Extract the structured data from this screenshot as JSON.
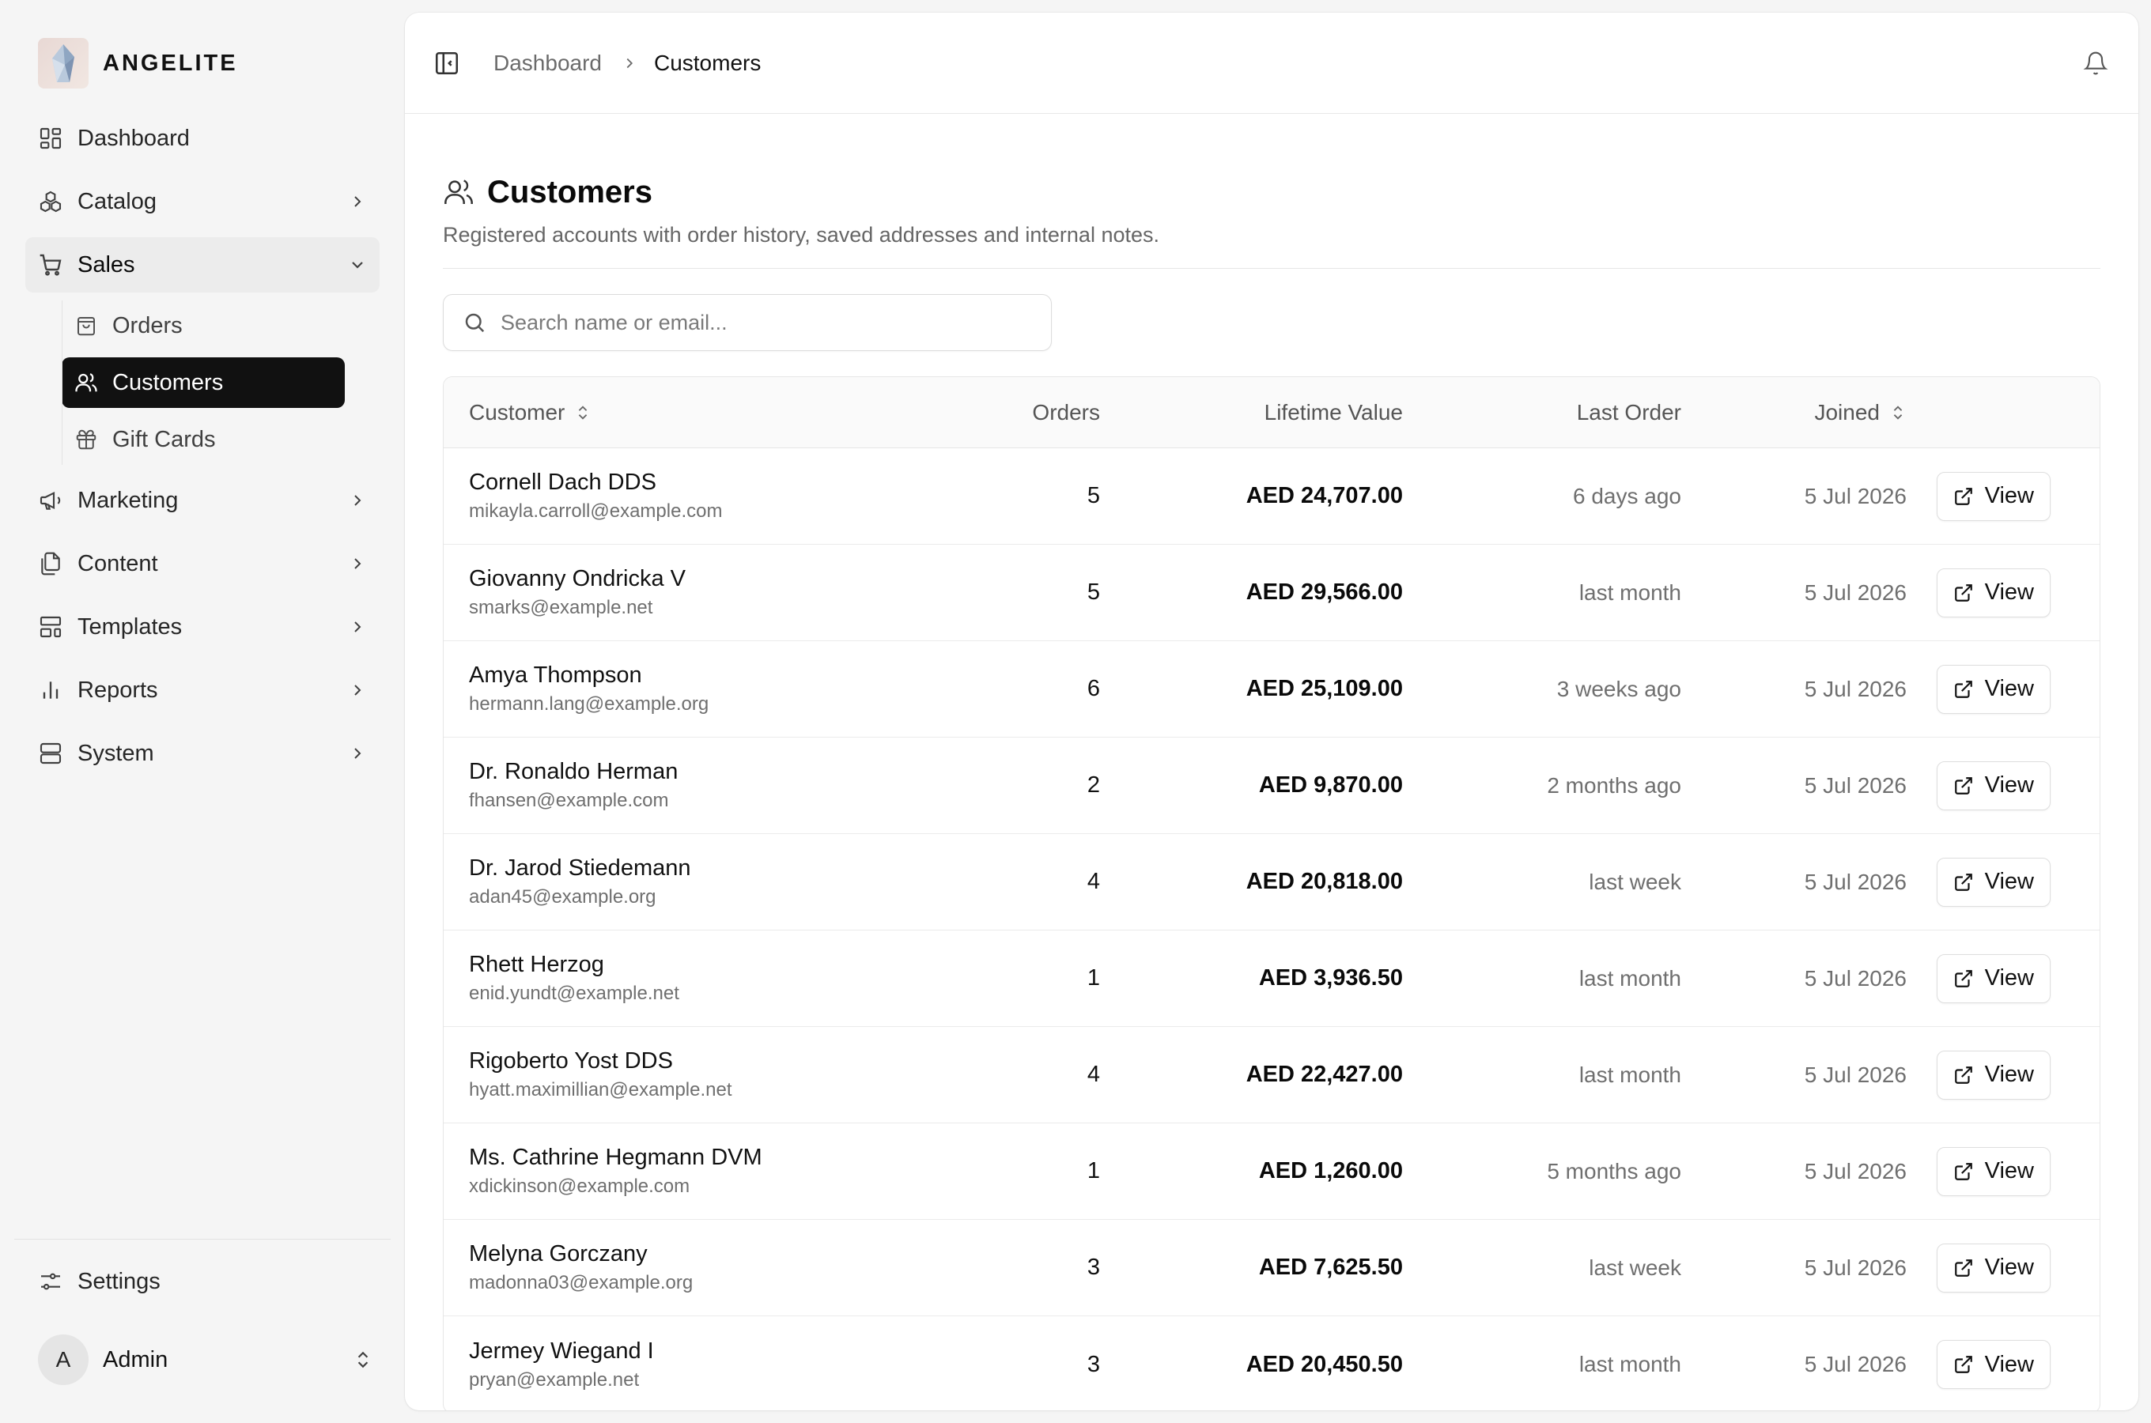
{
  "brand": {
    "name": "ANGELITE"
  },
  "sidebar": {
    "items": [
      {
        "label": "Dashboard",
        "icon": "layout-dashboard-icon"
      },
      {
        "label": "Catalog",
        "icon": "boxes-icon"
      },
      {
        "label": "Sales",
        "icon": "shopping-cart-icon",
        "expanded": true,
        "children": [
          {
            "label": "Orders",
            "icon": "shopping-bag-icon"
          },
          {
            "label": "Customers",
            "icon": "users-icon",
            "active": true
          },
          {
            "label": "Gift Cards",
            "icon": "gift-icon"
          }
        ]
      },
      {
        "label": "Marketing",
        "icon": "megaphone-icon"
      },
      {
        "label": "Content",
        "icon": "files-icon"
      },
      {
        "label": "Templates",
        "icon": "layout-template-icon"
      },
      {
        "label": "Reports",
        "icon": "bar-chart-icon"
      },
      {
        "label": "System",
        "icon": "server-icon"
      }
    ],
    "settings": {
      "label": "Settings",
      "icon": "sliders-icon"
    },
    "user": {
      "initial": "A",
      "name": "Admin"
    }
  },
  "topbar": {
    "breadcrumb": {
      "parent": "Dashboard",
      "current": "Customers"
    }
  },
  "page": {
    "title": "Customers",
    "subtitle": "Registered accounts with order history, saved addresses and internal notes."
  },
  "search": {
    "placeholder": "Search name or email...",
    "value": ""
  },
  "table": {
    "columns": {
      "customer": "Customer",
      "orders": "Orders",
      "lifetime_value": "Lifetime Value",
      "last_order": "Last Order",
      "joined": "Joined"
    },
    "action_label": "View",
    "rows": [
      {
        "name": "Cornell Dach DDS",
        "email": "mikayla.carroll@example.com",
        "orders": "5",
        "value": "AED 24,707.00",
        "last_order": "6 days ago",
        "joined": "5 Jul 2026"
      },
      {
        "name": "Giovanny Ondricka V",
        "email": "smarks@example.net",
        "orders": "5",
        "value": "AED 29,566.00",
        "last_order": "last month",
        "joined": "5 Jul 2026"
      },
      {
        "name": "Amya Thompson",
        "email": "hermann.lang@example.org",
        "orders": "6",
        "value": "AED 25,109.00",
        "last_order": "3 weeks ago",
        "joined": "5 Jul 2026"
      },
      {
        "name": "Dr. Ronaldo Herman",
        "email": "fhansen@example.com",
        "orders": "2",
        "value": "AED 9,870.00",
        "last_order": "2 months ago",
        "joined": "5 Jul 2026"
      },
      {
        "name": "Dr. Jarod Stiedemann",
        "email": "adan45@example.org",
        "orders": "4",
        "value": "AED 20,818.00",
        "last_order": "last week",
        "joined": "5 Jul 2026"
      },
      {
        "name": "Rhett Herzog",
        "email": "enid.yundt@example.net",
        "orders": "1",
        "value": "AED 3,936.50",
        "last_order": "last month",
        "joined": "5 Jul 2026"
      },
      {
        "name": "Rigoberto Yost DDS",
        "email": "hyatt.maximillian@example.net",
        "orders": "4",
        "value": "AED 22,427.00",
        "last_order": "last month",
        "joined": "5 Jul 2026"
      },
      {
        "name": "Ms. Cathrine Hegmann DVM",
        "email": "xdickinson@example.com",
        "orders": "1",
        "value": "AED 1,260.00",
        "last_order": "5 months ago",
        "joined": "5 Jul 2026"
      },
      {
        "name": "Melyna Gorczany",
        "email": "madonna03@example.org",
        "orders": "3",
        "value": "AED 7,625.50",
        "last_order": "last week",
        "joined": "5 Jul 2026"
      },
      {
        "name": "Jermey Wiegand I",
        "email": "pryan@example.net",
        "orders": "3",
        "value": "AED 20,450.50",
        "last_order": "last month",
        "joined": "5 Jul 2026"
      }
    ]
  },
  "colors": {
    "active_nav_bg": "#111111",
    "page_bg": "#f5f5f5",
    "panel_bg": "#ffffff"
  }
}
